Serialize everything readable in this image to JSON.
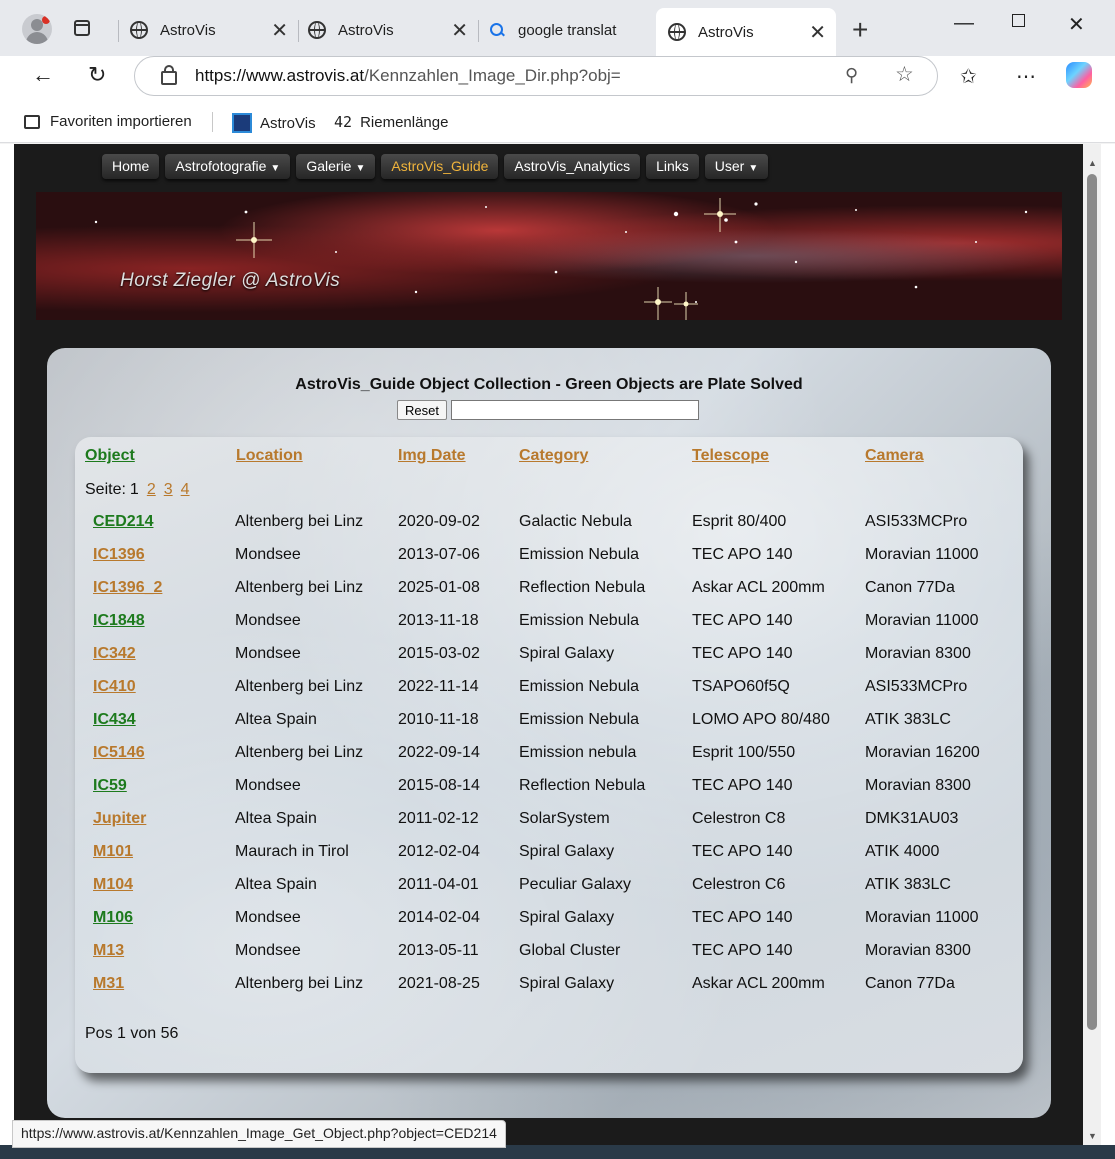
{
  "browser": {
    "tabs": [
      {
        "title": "AstroVis"
      },
      {
        "title": "AstroVis"
      },
      {
        "title": "google translat"
      },
      {
        "title": "AstroVis",
        "active": true
      }
    ],
    "url_host": "https://www.astrovis.at",
    "url_path": "/Kennzahlen_Image_Dir.php?obj=",
    "favorites": [
      {
        "label": "Favoriten importieren"
      },
      {
        "label": "AstroVis"
      },
      {
        "label": "Riemenlänge"
      }
    ],
    "status_url": "https://www.astrovis.at/Kennzahlen_Image_Get_Object.php?object=CED214"
  },
  "site": {
    "menu": [
      {
        "label": "Home",
        "dropdown": false
      },
      {
        "label": "Astrofotografie",
        "dropdown": true
      },
      {
        "label": "Galerie",
        "dropdown": true
      },
      {
        "label": "AstroVis_Guide",
        "dropdown": false,
        "active": true
      },
      {
        "label": "AstroVis_Analytics",
        "dropdown": false
      },
      {
        "label": "Links",
        "dropdown": false
      },
      {
        "label": "User",
        "dropdown": true
      }
    ],
    "banner_signature": "Horst Ziegler @ AstroVis",
    "title": "AstroVis_Guide Object Collection - Green Objects are Plate Solved",
    "reset_label": "Reset",
    "search_value": ""
  },
  "table": {
    "headers": {
      "object": "Object",
      "location": "Location",
      "date": "Img Date",
      "category": "Category",
      "telescope": "Telescope",
      "camera": "Camera"
    },
    "pager_label": "Seite:",
    "current_page": "1",
    "pages": [
      "2",
      "3",
      "4"
    ],
    "rows": [
      {
        "object": "CED214",
        "solved": true,
        "location": "Altenberg bei Linz",
        "date": "2020-09-02",
        "category": "Galactic Nebula",
        "telescope": "Esprit 80/400",
        "camera": "ASI533MCPro"
      },
      {
        "object": "IC1396",
        "solved": false,
        "location": "Mondsee",
        "date": "2013-07-06",
        "category": "Emission Nebula",
        "telescope": "TEC APO 140",
        "camera": "Moravian 11000"
      },
      {
        "object": "IC1396_2",
        "solved": false,
        "location": "Altenberg bei Linz",
        "date": "2025-01-08",
        "category": "Reflection Nebula",
        "telescope": "Askar ACL 200mm",
        "camera": "Canon 77Da"
      },
      {
        "object": "IC1848",
        "solved": true,
        "location": "Mondsee",
        "date": "2013-11-18",
        "category": "Emission Nebula",
        "telescope": "TEC APO 140",
        "camera": "Moravian 11000"
      },
      {
        "object": "IC342",
        "solved": false,
        "location": "Mondsee",
        "date": "2015-03-02",
        "category": "Spiral Galaxy",
        "telescope": "TEC APO 140",
        "camera": "Moravian 8300"
      },
      {
        "object": "IC410",
        "solved": false,
        "location": "Altenberg bei Linz",
        "date": "2022-11-14",
        "category": "Emission Nebula",
        "telescope": "TSAPO60f5Q",
        "camera": "ASI533MCPro"
      },
      {
        "object": "IC434",
        "solved": true,
        "location": "Altea Spain",
        "date": "2010-11-18",
        "category": "Emission Nebula",
        "telescope": "LOMO APO 80/480",
        "camera": "ATIK 383LC"
      },
      {
        "object": "IC5146",
        "solved": false,
        "location": "Altenberg bei Linz",
        "date": "2022-09-14",
        "category": "Emission nebula",
        "telescope": "Esprit 100/550",
        "camera": "Moravian 16200"
      },
      {
        "object": "IC59",
        "solved": true,
        "location": "Mondsee",
        "date": "2015-08-14",
        "category": "Reflection Nebula",
        "telescope": "TEC APO 140",
        "camera": "Moravian 8300"
      },
      {
        "object": "Jupiter",
        "solved": false,
        "location": "Altea Spain",
        "date": "2011-02-12",
        "category": "SolarSystem",
        "telescope": "Celestron C8",
        "camera": "DMK31AU03"
      },
      {
        "object": "M101",
        "solved": false,
        "location": "Maurach in Tirol",
        "date": "2012-02-04",
        "category": "Spiral Galaxy",
        "telescope": "TEC APO 140",
        "camera": "ATIK 4000"
      },
      {
        "object": "M104",
        "solved": false,
        "location": "Altea Spain",
        "date": "2011-04-01",
        "category": "Peculiar Galaxy",
        "telescope": "Celestron C6",
        "camera": "ATIK 383LC"
      },
      {
        "object": "M106",
        "solved": true,
        "location": "Mondsee",
        "date": "2014-02-04",
        "category": "Spiral Galaxy",
        "telescope": "TEC APO 140",
        "camera": "Moravian 11000"
      },
      {
        "object": "M13",
        "solved": false,
        "location": "Mondsee",
        "date": "2013-05-11",
        "category": "Global Cluster",
        "telescope": "TEC APO 140",
        "camera": "Moravian 8300"
      },
      {
        "object": "M31",
        "solved": false,
        "location": "Altenberg bei Linz",
        "date": "2021-08-25",
        "category": "Spiral Galaxy",
        "telescope": "Askar ACL 200mm",
        "camera": "Canon 77Da"
      }
    ],
    "position_text": "Pos 1 von 56"
  },
  "colors": {
    "solved": "#1d7a1d",
    "unsolved": "#b8792d",
    "menu_active": "#f0b43c"
  }
}
